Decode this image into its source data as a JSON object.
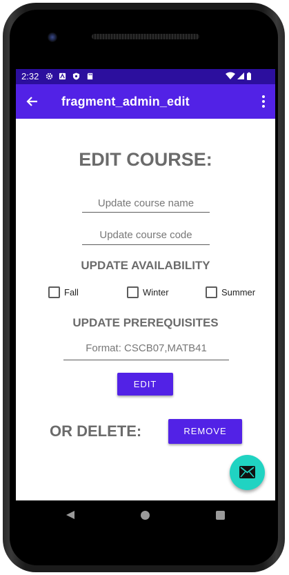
{
  "status_bar": {
    "time": "2:32",
    "left_icons": [
      "settings-icon",
      "accessibility-icon",
      "shield-icon",
      "sd-card-icon"
    ],
    "right_icons": [
      "wifi-icon",
      "signal-icon",
      "battery-icon"
    ],
    "background": "#2c0f9e"
  },
  "app_bar": {
    "title": "fragment_admin_edit",
    "background": "#5222e6"
  },
  "form": {
    "heading": "EDIT COURSE:",
    "course_name_placeholder": "Update course name",
    "course_code_placeholder": "Update course code",
    "availability_heading": "UPDATE AVAILABILITY",
    "availability_options": [
      {
        "label": "Fall",
        "checked": false
      },
      {
        "label": "Winter",
        "checked": false
      },
      {
        "label": "Summer",
        "checked": false
      }
    ],
    "prerequisites_heading": "UPDATE PREREQUISITES",
    "prerequisites_placeholder": "Format: CSCB07,MATB41",
    "edit_button": "EDIT",
    "delete_label": "OR DELETE:",
    "remove_button": "REMOVE"
  },
  "fab": {
    "icon": "mail-icon",
    "color": "#20d3c2"
  },
  "colors": {
    "accent": "#5222e6",
    "heading_text": "#6b6b6b"
  }
}
